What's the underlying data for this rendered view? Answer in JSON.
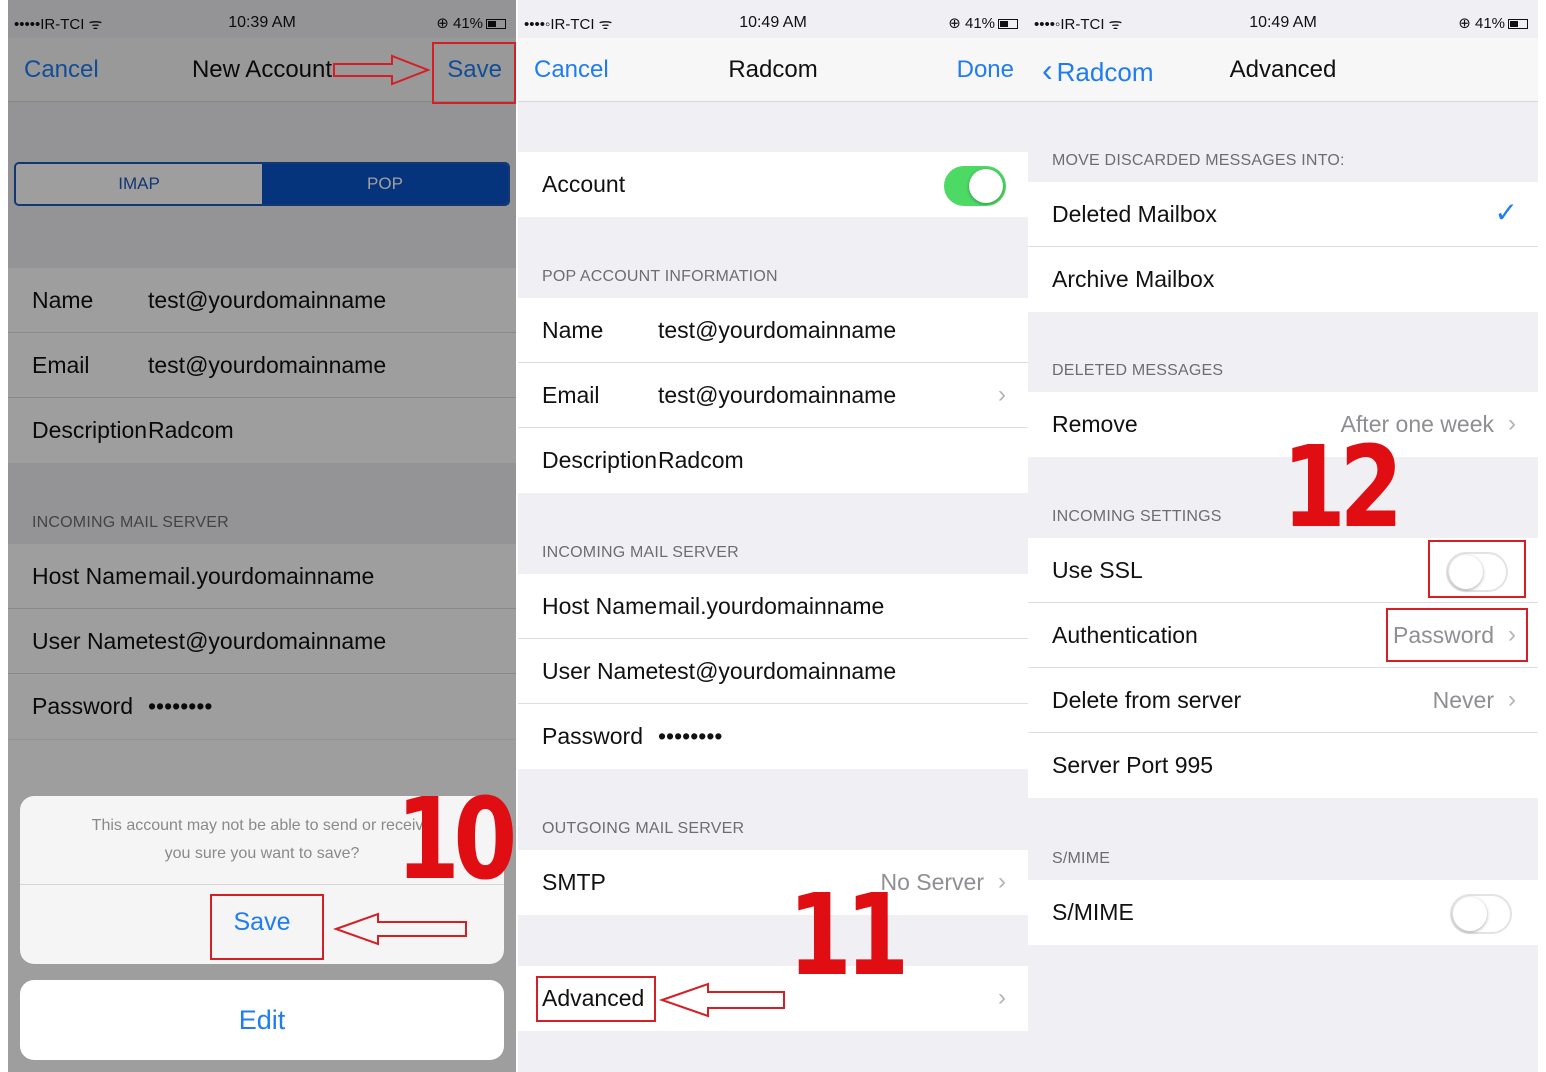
{
  "status1": {
    "carrier": "•••••IR-TCI ᯤ",
    "time": "10:39 AM",
    "battery": "⊕ 41%"
  },
  "status2": {
    "carrier": "••••◦IR-TCI ᯤ",
    "time": "10:49 AM",
    "battery": "⊕ 41%"
  },
  "status3": {
    "carrier": "••••◦IR-TCI ᯤ",
    "time": "10:49 AM",
    "battery": "⊕ 41%"
  },
  "screen1": {
    "nav": {
      "cancel": "Cancel",
      "title": "New Account",
      "save": "Save"
    },
    "segments": [
      "IMAP",
      "POP"
    ],
    "selected_segment": "POP",
    "account_rows": [
      {
        "label": "Name",
        "value": "test@yourdomainname"
      },
      {
        "label": "Email",
        "value": "test@yourdomainname"
      },
      {
        "label": "Description",
        "value": "Radcom"
      }
    ],
    "incoming_header": "INCOMING MAIL SERVER",
    "incoming_rows": [
      {
        "label": "Host Name",
        "value": "mail.yourdomainname"
      },
      {
        "label": "User Name",
        "value": "test@yourdomainname"
      },
      {
        "label": "Password",
        "value": "••••••••"
      }
    ],
    "alert": {
      "message_line1": "This account may not be able to send or receive",
      "message_line2": "you sure you want to save?",
      "save": "Save",
      "edit": "Edit"
    },
    "step": "10"
  },
  "screen2": {
    "nav": {
      "cancel": "Cancel",
      "title": "Radcom",
      "done": "Done"
    },
    "account_label": "Account",
    "account_on": true,
    "pop_header": "POP ACCOUNT INFORMATION",
    "pop_rows": [
      {
        "label": "Name",
        "value": "test@yourdomainname"
      },
      {
        "label": "Email",
        "value": "test@yourdomainname"
      },
      {
        "label": "Description",
        "value": "Radcom"
      }
    ],
    "incoming_header": "INCOMING MAIL SERVER",
    "incoming_rows": [
      {
        "label": "Host Name",
        "value": "mail.yourdomainname"
      },
      {
        "label": "User Name",
        "value": "test@yourdomainname"
      },
      {
        "label": "Password",
        "value": "••••••••"
      }
    ],
    "outgoing_header": "OUTGOING MAIL SERVER",
    "smtp_label": "SMTP",
    "smtp_value": "No Server",
    "advanced_label": "Advanced",
    "step": "11"
  },
  "screen3": {
    "nav": {
      "back": "Radcom",
      "title": "Advanced"
    },
    "move_header": "MOVE DISCARDED MESSAGES INTO:",
    "deleted_mailbox": "Deleted Mailbox",
    "archive_mailbox": "Archive Mailbox",
    "deleted_header": "DELETED MESSAGES",
    "remove_label": "Remove",
    "remove_value": "After one week",
    "incoming_header": "INCOMING SETTINGS",
    "use_ssl_label": "Use SSL",
    "use_ssl_on": false,
    "auth_label": "Authentication",
    "auth_value": "Password",
    "delete_label": "Delete from server",
    "delete_value": "Never",
    "server_port": "Server Port  995",
    "smime_header": "S/MIME",
    "smime_label": "S/MIME",
    "smime_on": false,
    "step": "12"
  },
  "colors": {
    "ios_blue": "#1f7cf2",
    "annotation_red": "#d41f25",
    "switch_green": "#4cd964"
  }
}
